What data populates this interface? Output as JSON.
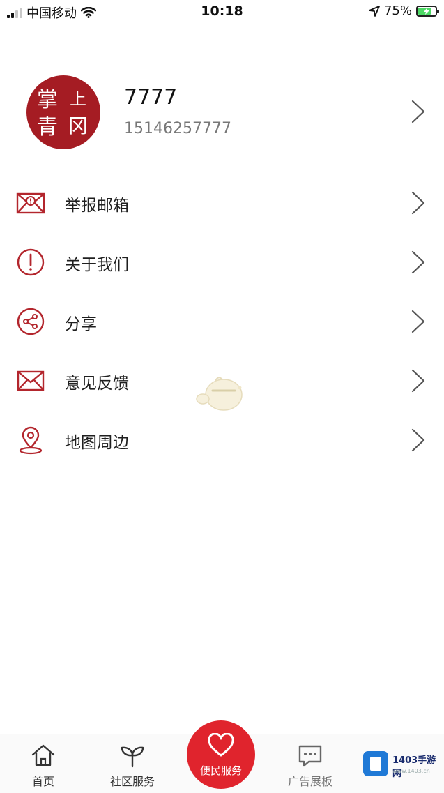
{
  "status_bar": {
    "carrier": "中国移动",
    "time": "10:18",
    "battery_percent": "75%",
    "battery_level": 0.75,
    "signal_bars_filled": 2,
    "icons": [
      "signal-icon",
      "wifi-icon",
      "location-arrow-icon",
      "battery-charging-icon"
    ]
  },
  "profile": {
    "avatar_text": [
      "掌",
      "上",
      "青",
      "冈"
    ],
    "name": "7777",
    "phone": "15146257777"
  },
  "menu": {
    "items": [
      {
        "label": "举报邮箱",
        "icon": "report-mail-icon"
      },
      {
        "label": "关于我们",
        "icon": "info-exclamation-icon"
      },
      {
        "label": "分享",
        "icon": "share-icon"
      },
      {
        "label": "意见反馈",
        "icon": "feedback-mail-icon"
      },
      {
        "label": "地图周边",
        "icon": "map-pin-icon"
      }
    ]
  },
  "tabbar": {
    "tabs": [
      {
        "label": "首页",
        "icon": "home-icon"
      },
      {
        "label": "社区服务",
        "icon": "sprout-icon"
      },
      {
        "label": "便民服务",
        "icon": "heart-icon",
        "active": true
      },
      {
        "label": "广告展板",
        "icon": "chat-bubble-icon"
      }
    ]
  },
  "watermark": {
    "title": "1403手游网",
    "subtitle": "www.1403.cn"
  },
  "colors": {
    "accent": "#e0242d",
    "avatar_bg": "#a51c23",
    "icon_stroke": "#b3262d",
    "chevron": "#555555"
  }
}
